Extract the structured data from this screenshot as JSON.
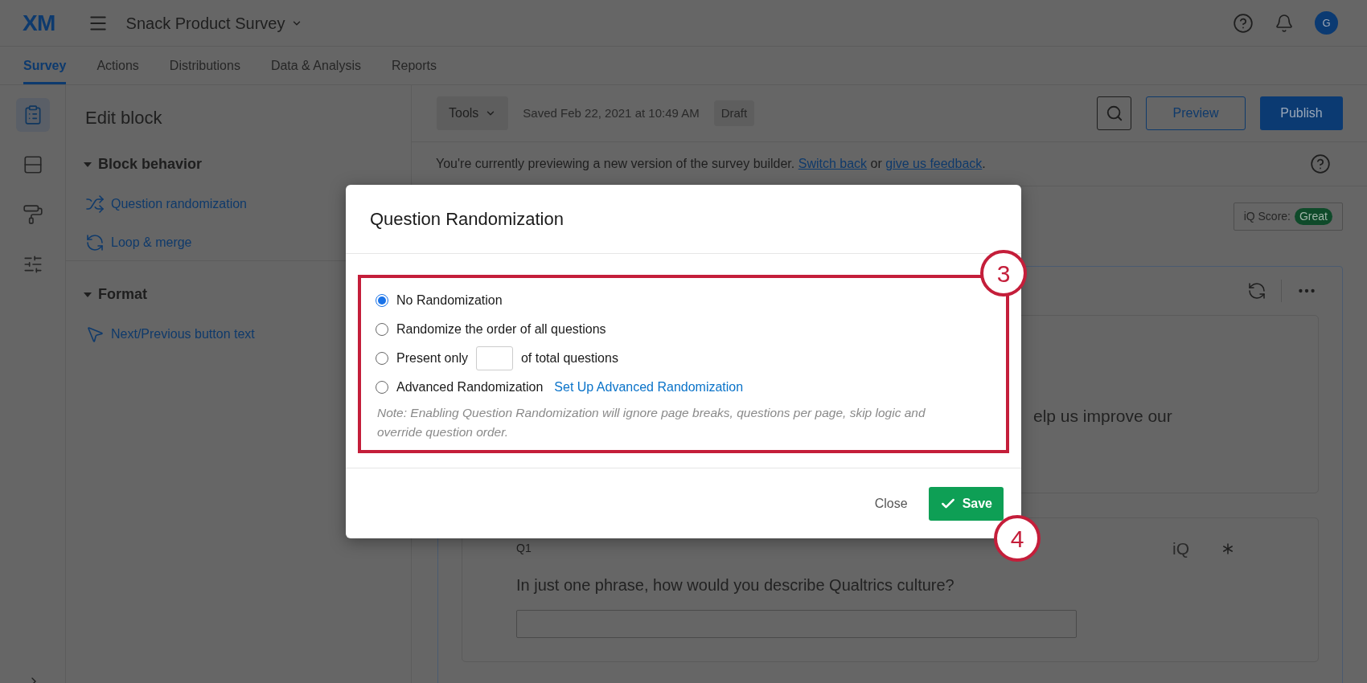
{
  "app": {
    "logo": "XM",
    "survey_title": "Snack Product Survey",
    "avatar_initial": "G"
  },
  "nav_tabs": [
    {
      "label": "Survey",
      "selected": true
    },
    {
      "label": "Actions",
      "selected": false
    },
    {
      "label": "Distributions",
      "selected": false
    },
    {
      "label": "Data & Analysis",
      "selected": false
    },
    {
      "label": "Reports",
      "selected": false
    }
  ],
  "icon_rail": [
    {
      "kind": "survey",
      "selected": true
    },
    {
      "kind": "blocks",
      "selected": false
    },
    {
      "kind": "look",
      "selected": false
    },
    {
      "kind": "options",
      "selected": false
    }
  ],
  "edit_panel": {
    "title": "Edit block",
    "sections": [
      {
        "title": "Block behavior",
        "expanded": true,
        "items": [
          {
            "kind": "shuffle",
            "label": "Question randomization"
          },
          {
            "kind": "loop",
            "label": "Loop & merge"
          }
        ]
      },
      {
        "title": "Format",
        "expanded": true,
        "items": [
          {
            "kind": "pointer",
            "label": "Next/Previous button text"
          }
        ]
      }
    ]
  },
  "toolbar": {
    "tools": "Tools",
    "saved": "Saved Feb 22, 2021 at 10:49 AM",
    "status": "Draft",
    "preview": "Preview",
    "publish": "Publish"
  },
  "banner": {
    "text": "You're currently previewing a new version of the survey builder.",
    "link_1": "Switch back",
    "joiner": "or",
    "link_2": "give us feedback",
    "end": "."
  },
  "iq_score": {
    "label": "iQ Score:",
    "badge": "Great"
  },
  "block": {
    "intro_fragment": "elp us improve our",
    "question": {
      "number": "Q1",
      "iq": "iQ",
      "text": "In just one phrase, how would you describe Qualtrics culture?"
    }
  },
  "dialog": {
    "title": "Question Randomization",
    "options": [
      {
        "kind": "plain",
        "label": "No Randomization",
        "selected": true
      },
      {
        "kind": "plain",
        "label": "Randomize the order of all questions",
        "selected": false
      },
      {
        "kind": "count",
        "label": "Present only",
        "label_after": "of total questions",
        "selected": false
      },
      {
        "kind": "advanced",
        "label": "Advanced Randomization",
        "link": "Set Up Advanced Randomization",
        "selected": false
      }
    ],
    "note": "Note: Enabling Question Randomization will ignore page breaks, questions per page, skip logic and override question order.",
    "close": "Close",
    "save": "Save"
  },
  "callouts": [
    "3",
    "4"
  ]
}
